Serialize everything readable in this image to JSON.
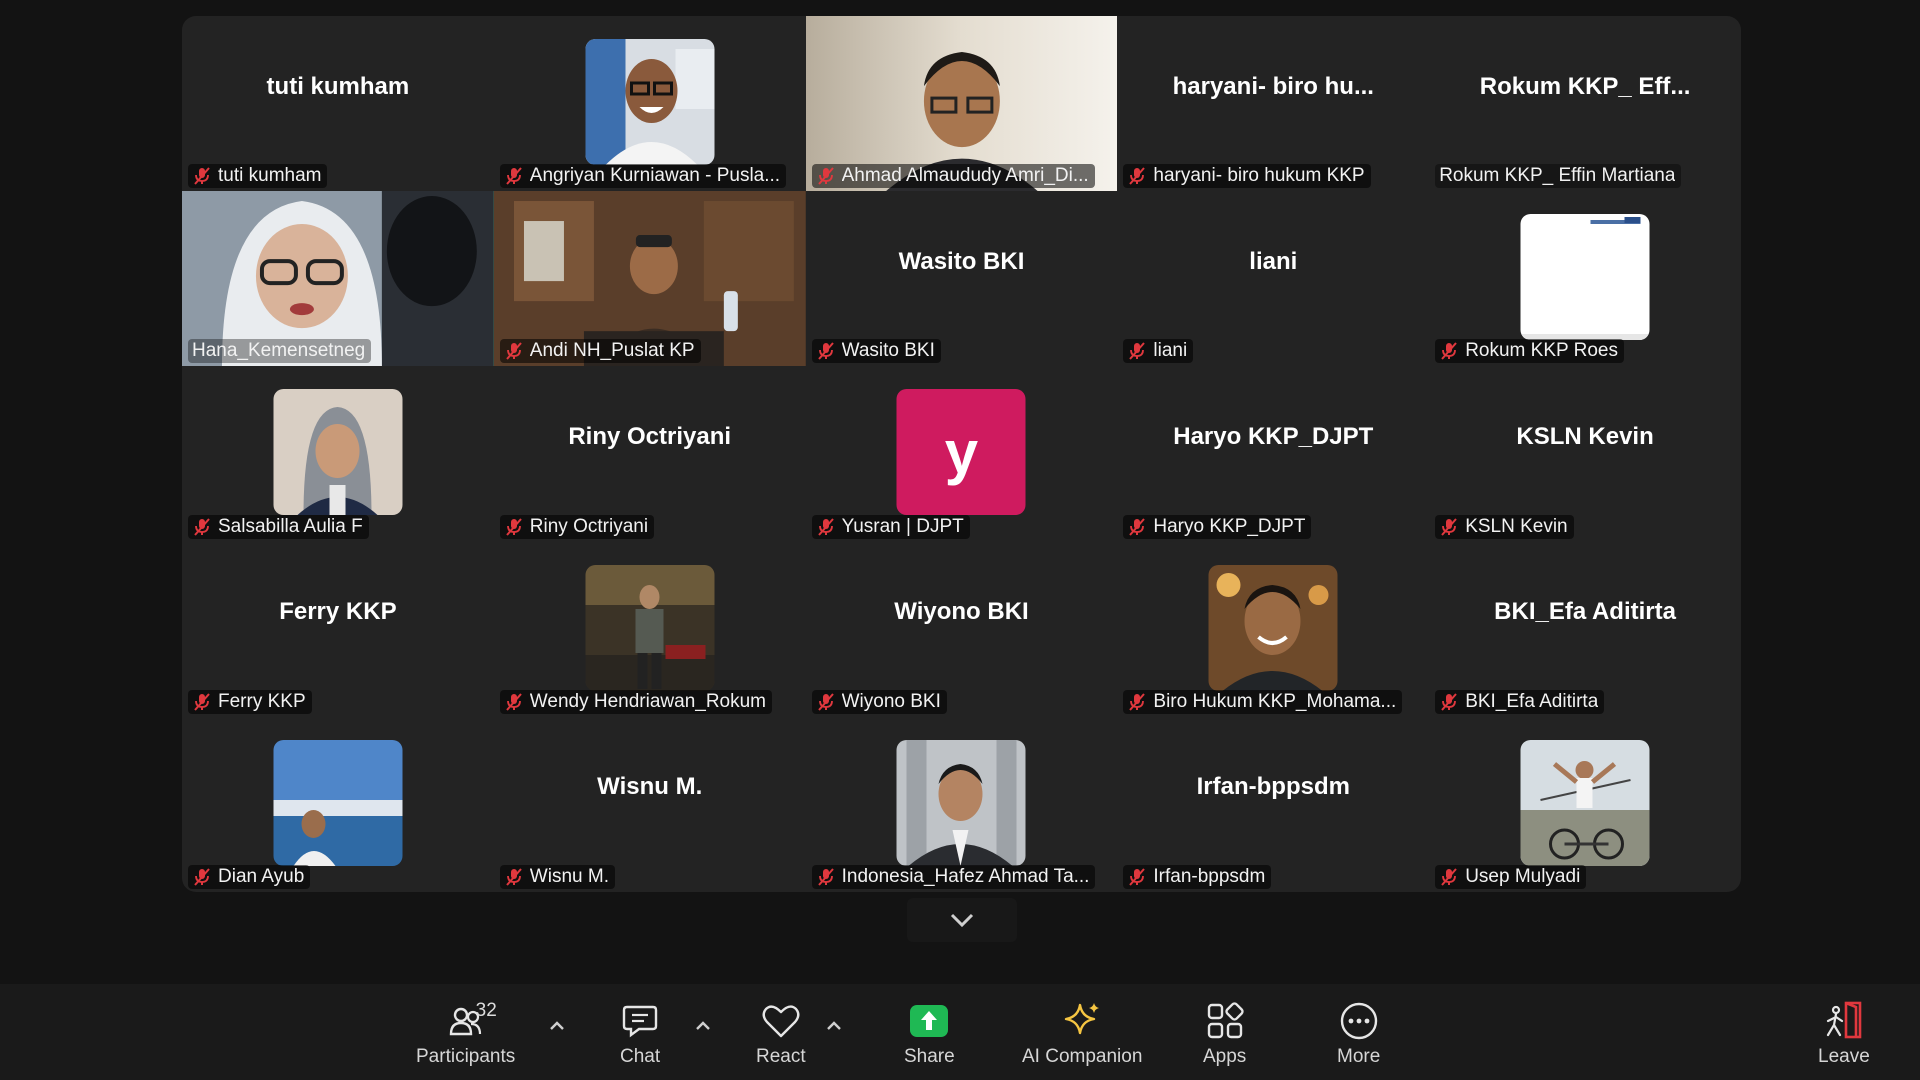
{
  "tiles": [
    {
      "center": "tuti kumham",
      "name": "tuti kumham",
      "muted": true,
      "kind": "name"
    },
    {
      "name": "Angriyan Kurniawan - Pusla...",
      "muted": true,
      "kind": "photo",
      "icon": "man-glasses-photo"
    },
    {
      "name": "Ahmad Almaududy Amri_Di...",
      "muted": true,
      "kind": "video",
      "icon": "man-video"
    },
    {
      "center": "haryani- biro hu...",
      "name": "haryani- biro hukum KKP",
      "muted": true,
      "kind": "name"
    },
    {
      "center": "Rokum KKP_ Eff...",
      "name": "Rokum KKP_ Effin Martiana",
      "muted": false,
      "kind": "name"
    },
    {
      "name": "Hana_Kemensetneg",
      "muted": false,
      "kind": "video",
      "icon": "woman-hijab-video",
      "active": true
    },
    {
      "name": "Andi NH_Puslat KP",
      "muted": true,
      "kind": "video",
      "icon": "man-room-video"
    },
    {
      "center": "Wasito BKI",
      "name": "Wasito BKI",
      "muted": true,
      "kind": "name"
    },
    {
      "center": "liani",
      "name": "liani",
      "muted": true,
      "kind": "name"
    },
    {
      "name": "Rokum KKP Roes",
      "muted": true,
      "kind": "photo",
      "icon": "document-photo"
    },
    {
      "name": "Salsabilla Aulia F",
      "muted": true,
      "kind": "photo",
      "icon": "woman-hijab-photo"
    },
    {
      "center": "Riny Octriyani",
      "name": "Riny Octriyani",
      "muted": true,
      "kind": "name"
    },
    {
      "letter": "y",
      "name": "Yusran | DJPT",
      "muted": true,
      "kind": "letter"
    },
    {
      "center": "Haryo KKP_DJPT",
      "name": "Haryo KKP_DJPT",
      "muted": true,
      "kind": "name"
    },
    {
      "center": "KSLN Kevin",
      "name": "KSLN Kevin",
      "muted": true,
      "kind": "name"
    },
    {
      "center": "Ferry KKP",
      "name": "Ferry KKP",
      "muted": true,
      "kind": "name"
    },
    {
      "name": "Wendy Hendriawan_Rokum",
      "muted": true,
      "kind": "photo",
      "icon": "man-standing-photo"
    },
    {
      "center": "Wiyono BKI",
      "name": "Wiyono BKI",
      "muted": true,
      "kind": "name"
    },
    {
      "name": "Biro Hukum KKP_Mohama...",
      "muted": true,
      "kind": "photo",
      "icon": "man-portrait-photo"
    },
    {
      "center": "BKI_Efa Aditirta",
      "name": "BKI_Efa Aditirta",
      "muted": true,
      "kind": "name"
    },
    {
      "name": "Dian Ayub",
      "muted": true,
      "kind": "photo",
      "icon": "lake-photo"
    },
    {
      "center": "Wisnu M.",
      "name": "Wisnu M.",
      "muted": true,
      "kind": "name"
    },
    {
      "name": "Indonesia_Hafez Ahmad Ta...",
      "muted": true,
      "kind": "photo",
      "icon": "man-suit-photo"
    },
    {
      "center": "Irfan-bppsdm",
      "name": "Irfan-bppsdm",
      "muted": true,
      "kind": "name"
    },
    {
      "name": "Usep Mulyadi",
      "muted": true,
      "kind": "photo",
      "icon": "cyclist-photo"
    }
  ],
  "toolbar": {
    "participants_label": "Participants",
    "participants_count": "32",
    "chat_label": "Chat",
    "react_label": "React",
    "share_label": "Share",
    "ai_label": "AI Companion",
    "apps_label": "Apps",
    "more_label": "More",
    "leave_label": "Leave"
  },
  "colors": {
    "active_speaker": "#23d959",
    "muted_icon": "#e0383e",
    "share_green": "#1fb954",
    "leave_red": "#e0383e",
    "letter_avatar": "#cf1b5f",
    "ai_gold": "#f5c542"
  }
}
